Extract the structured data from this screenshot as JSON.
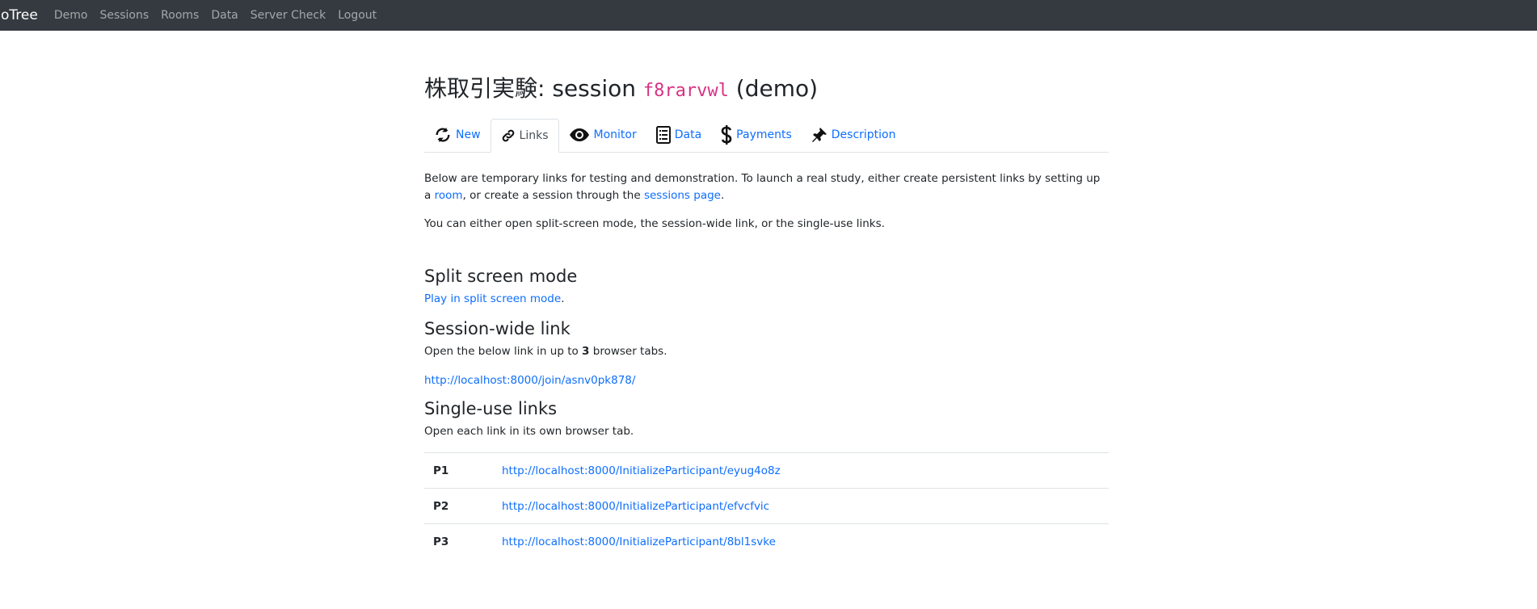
{
  "navbar": {
    "brand": "oTree",
    "links": [
      "Demo",
      "Sessions",
      "Rooms",
      "Data",
      "Server Check",
      "Logout"
    ]
  },
  "page": {
    "title_prefix": "株取引実験: session",
    "session_code": "f8rarvwl",
    "title_suffix": "(demo)"
  },
  "tabs": [
    {
      "label": "New",
      "icon": "refresh-icon"
    },
    {
      "label": "Links",
      "icon": "link-icon"
    },
    {
      "label": "Monitor",
      "icon": "eye-icon"
    },
    {
      "label": "Data",
      "icon": "list-icon"
    },
    {
      "label": "Payments",
      "icon": "dollar-icon"
    },
    {
      "label": "Description",
      "icon": "pin-icon"
    }
  ],
  "intro": {
    "text1": "Below are temporary links for testing and demonstration. To launch a real study, either create persistent links by setting up a ",
    "room_link": "room",
    "text2": ", or create a session through the ",
    "sessions_link": "sessions page",
    "text3": ".",
    "text4": "You can either open split-screen mode, the session-wide link, or the single-use links."
  },
  "split": {
    "heading": "Split screen mode",
    "link": "Play in split screen mode",
    "after": "."
  },
  "session_wide": {
    "heading": "Session-wide link",
    "text_before": "Open the below link in up to ",
    "count": "3",
    "text_after": " browser tabs.",
    "url": "http://localhost:8000/join/asnv0pk878/"
  },
  "single_use": {
    "heading": "Single-use links",
    "text": "Open each link in its own browser tab.",
    "rows": [
      {
        "label": "P1",
        "url": "http://localhost:8000/InitializeParticipant/eyug4o8z"
      },
      {
        "label": "P2",
        "url": "http://localhost:8000/InitializeParticipant/efvcfvic"
      },
      {
        "label": "P3",
        "url": "http://localhost:8000/InitializeParticipant/8bl1svke"
      }
    ]
  }
}
